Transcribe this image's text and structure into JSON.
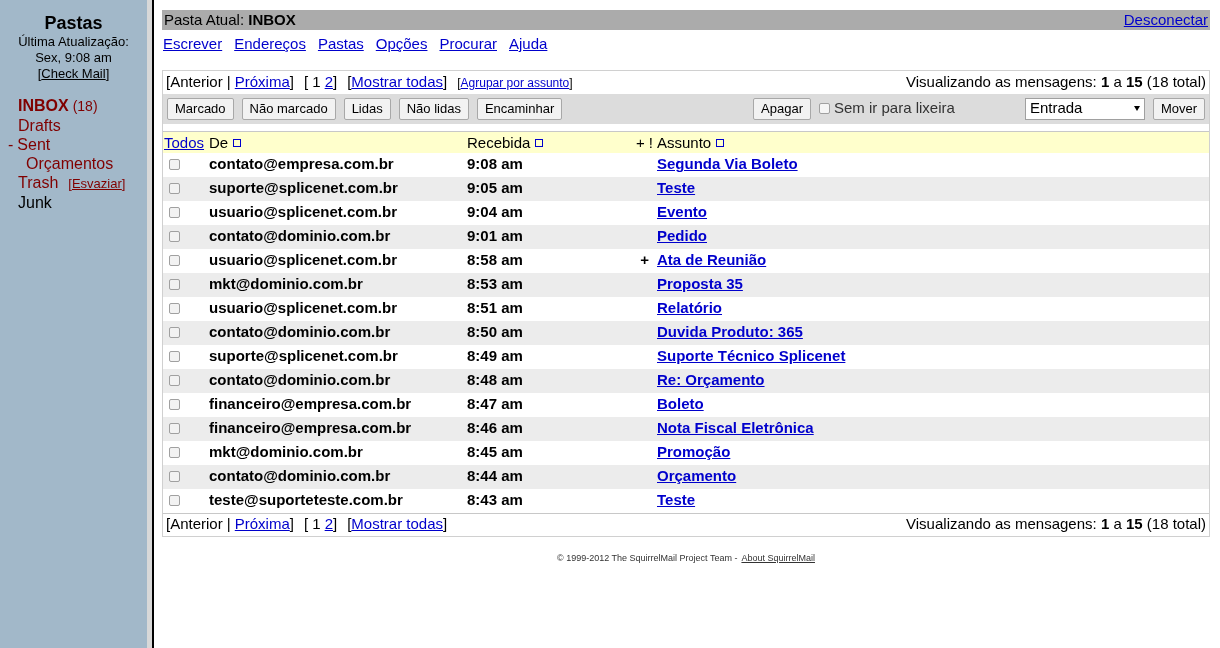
{
  "sidebar": {
    "title": "Pastas",
    "updated_label": "Última Atualização:",
    "updated_time": "Sex, 9:08 am",
    "check_mail": {
      "open": "[",
      "label": "Check Mail",
      "close": "]"
    },
    "folders": [
      {
        "name": "INBOX",
        "count": "(18)",
        "current": true,
        "link": true
      },
      {
        "name": "Drafts",
        "current": false,
        "link": true
      },
      {
        "name": "Sent",
        "toggle": "-",
        "current": false,
        "link": true,
        "children": [
          {
            "name": "Orçamentos",
            "current": false,
            "link": true
          }
        ]
      },
      {
        "name": "Trash",
        "action": {
          "open": "[",
          "label": "Esvaziar",
          "close": "]"
        },
        "current": false,
        "link": true
      },
      {
        "name": "Junk",
        "current": false,
        "link": false
      }
    ]
  },
  "top_bar": {
    "current_folder": "Pasta Atual: **INBOX**",
    "sign_out": "Desconectar"
  },
  "menu": [
    "Escrever",
    "Endereços",
    "Pastas",
    "Opções",
    "Procurar",
    "Ajuda"
  ],
  "pager_top": {
    "segments": [
      {
        "kind": "text",
        "text": "[Anterior |"
      },
      {
        "kind": "link",
        "text": "Próxima"
      },
      {
        "kind": "text",
        "text": "]"
      },
      {
        "kind": "text",
        "text": "[ 1"
      },
      {
        "kind": "link",
        "text": "2"
      },
      {
        "kind": "text",
        "text": "]"
      },
      {
        "kind": "text",
        "text": "["
      },
      {
        "kind": "link",
        "text": "Mostrar todas"
      },
      {
        "kind": "text",
        "text": "]"
      },
      {
        "kind": "small_text",
        "text": "["
      },
      {
        "kind": "small_link",
        "text": "Agrupar por assunto"
      },
      {
        "kind": "small_text",
        "text": "]"
      }
    ],
    "status": "Visualizando as mensagens: **1** a **15** (18 total)"
  },
  "toolbar": {
    "buttons": [
      "Marcado",
      "Não marcado",
      "Lidas",
      "Não lidas",
      "Encaminhar"
    ],
    "delete_button": "Apagar",
    "no_trash": {
      "label": "Sem ir para lixeira",
      "checked": false
    },
    "move_target": "Entrada",
    "move_button": "Mover"
  },
  "table": {
    "columns": [
      {
        "label": "Todos",
        "kind": "link"
      },
      {
        "label": "De",
        "kind": "sort"
      },
      {
        "label": "Recebida",
        "kind": "sort"
      },
      {
        "label": "+ !",
        "kind": "text"
      },
      {
        "label": "Assunto",
        "kind": "sort"
      }
    ],
    "rows": [
      {
        "checked": false,
        "unread": true,
        "from": "contato@empresa.com.br",
        "received": "9:08 am",
        "subject": "Segunda Via Boleto"
      },
      {
        "checked": false,
        "unread": true,
        "from": "suporte@splicenet.com.br",
        "received": "9:05 am",
        "subject": "Teste"
      },
      {
        "checked": false,
        "unread": true,
        "from": "usuario@splicenet.com.br",
        "received": "9:04 am",
        "subject": "Evento"
      },
      {
        "checked": false,
        "unread": true,
        "from": "contato@dominio.com.br",
        "received": "9:01 am",
        "subject": "Pedido"
      },
      {
        "checked": false,
        "unread": true,
        "from": "usuario@splicenet.com.br",
        "received": "8:58 am",
        "flags": "+",
        "subject": "Ata de Reunião"
      },
      {
        "checked": false,
        "unread": true,
        "from": "mkt@dominio.com.br",
        "received": "8:53 am",
        "subject": "Proposta 35"
      },
      {
        "checked": false,
        "unread": true,
        "from": "usuario@splicenet.com.br",
        "received": "8:51 am",
        "subject": "Relatório"
      },
      {
        "checked": false,
        "unread": true,
        "from": "contato@dominio.com.br",
        "received": "8:50 am",
        "subject": "Duvida Produto: 365"
      },
      {
        "checked": false,
        "unread": true,
        "from": "suporte@splicenet.com.br",
        "received": "8:49 am",
        "subject": "Suporte Técnico Splicenet"
      },
      {
        "checked": false,
        "unread": true,
        "from": "contato@dominio.com.br",
        "received": "8:48 am",
        "subject": "Re: Orçamento"
      },
      {
        "checked": false,
        "unread": true,
        "from": "financeiro@empresa.com.br",
        "received": "8:47 am",
        "subject": "Boleto"
      },
      {
        "checked": false,
        "unread": true,
        "from": "financeiro@empresa.com.br",
        "received": "8:46 am",
        "subject": "Nota Fiscal Eletrônica"
      },
      {
        "checked": false,
        "unread": true,
        "from": "mkt@dominio.com.br",
        "received": "8:45 am",
        "subject": "Promoção"
      },
      {
        "checked": false,
        "unread": true,
        "from": "contato@dominio.com.br",
        "received": "8:44 am",
        "subject": "Orçamento"
      },
      {
        "checked": false,
        "unread": true,
        "from": "teste@suporteteste.com.br",
        "received": "8:43 am",
        "subject": "Teste"
      }
    ]
  },
  "pager_bottom": {
    "segments": [
      {
        "kind": "text",
        "text": "[Anterior |"
      },
      {
        "kind": "link",
        "text": "Próxima"
      },
      {
        "kind": "text",
        "text": "]"
      },
      {
        "kind": "text",
        "text": "[ 1"
      },
      {
        "kind": "link",
        "text": "2"
      },
      {
        "kind": "text",
        "text": "]"
      },
      {
        "kind": "text",
        "text": "["
      },
      {
        "kind": "link",
        "text": "Mostrar todas"
      },
      {
        "kind": "text",
        "text": "]"
      }
    ],
    "status": "Visualizando as mensagens: **1** a **15** (18 total)"
  },
  "footer": {
    "copyright": "© 1999-2012 The SquirrelMail Project Team -",
    "about": "About SquirrelMail"
  }
}
